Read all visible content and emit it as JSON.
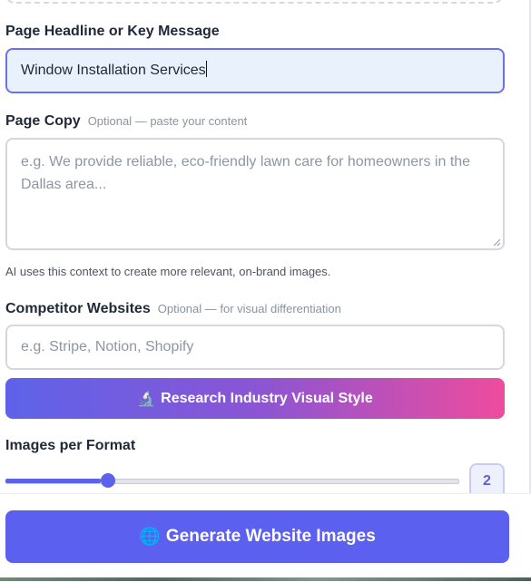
{
  "headline": {
    "label": "Page Headline or Key Message",
    "value": "Window Installation Services"
  },
  "page_copy": {
    "label": "Page Copy",
    "hint": "Optional — paste your content",
    "placeholder": "e.g. We provide reliable, eco-friendly lawn care for homeowners in the Dallas area..."
  },
  "help_text": "AI uses this context to create more relevant, on-brand images.",
  "competitors": {
    "label": "Competitor Websites",
    "hint": "Optional — for visual differentiation",
    "placeholder": "e.g. Stripe, Notion, Shopify"
  },
  "research_button": {
    "icon": "🔬",
    "label": "Research Industry Visual Style"
  },
  "images_per_format": {
    "label": "Images per Format",
    "value": "2",
    "slider_fraction": 0.21
  },
  "generate_button": {
    "icon": "🌐",
    "label": "Generate Website Images"
  },
  "colors": {
    "accent": "#5c60ee",
    "gradient_start": "#5d63e9",
    "gradient_end": "#ee4c9d"
  }
}
